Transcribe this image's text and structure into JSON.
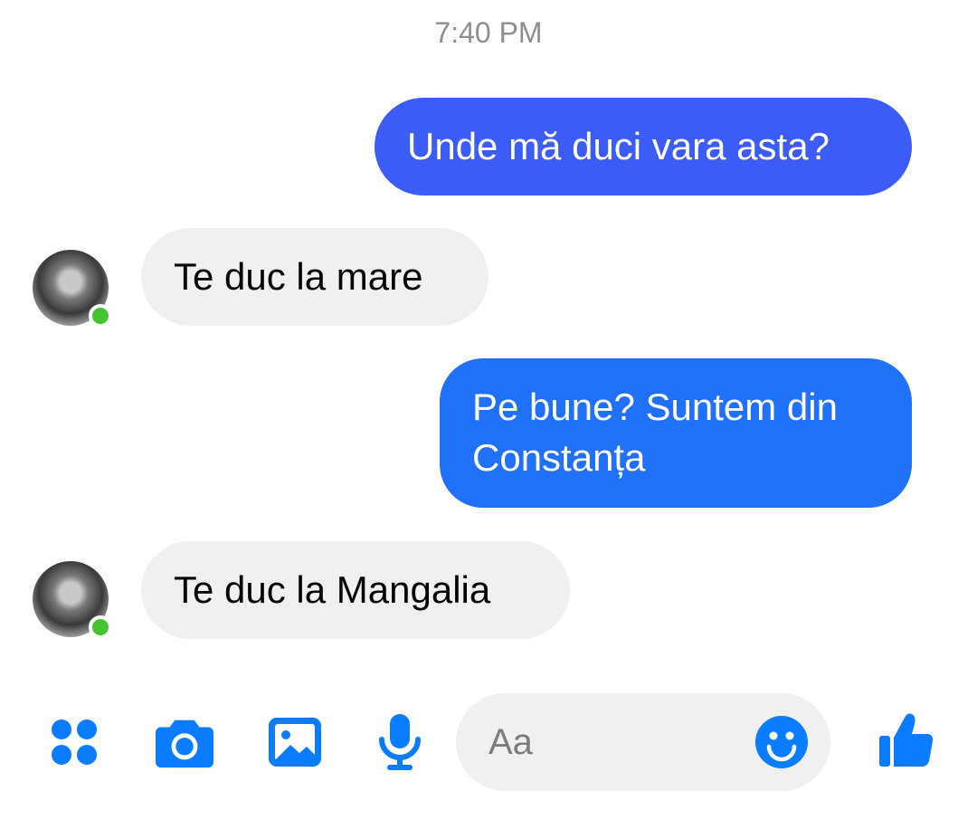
{
  "header": {
    "timestamp": "7:40 PM"
  },
  "messages": [
    {
      "direction": "out",
      "text": "Unde mă duci vara asta?"
    },
    {
      "direction": "in",
      "text": "Te duc la mare"
    },
    {
      "direction": "out",
      "text": "Pe bune? Suntem din Constanța"
    },
    {
      "direction": "in",
      "text": "Te duc la Mangalia"
    }
  ],
  "composer": {
    "placeholder": "Aa",
    "value": ""
  },
  "toolbar": {
    "icons": [
      "apps-grid-icon",
      "camera-icon",
      "image-icon",
      "microphone-icon",
      "emoji-icon",
      "thumbs-up-icon"
    ]
  },
  "colors": {
    "accent": "#0a7cff",
    "outgoing_bubble_top": "#3b5cf7",
    "outgoing_bubble_bottom": "#2070f8",
    "incoming_bubble": "#f0f0f2",
    "online_dot": "#44c530"
  }
}
